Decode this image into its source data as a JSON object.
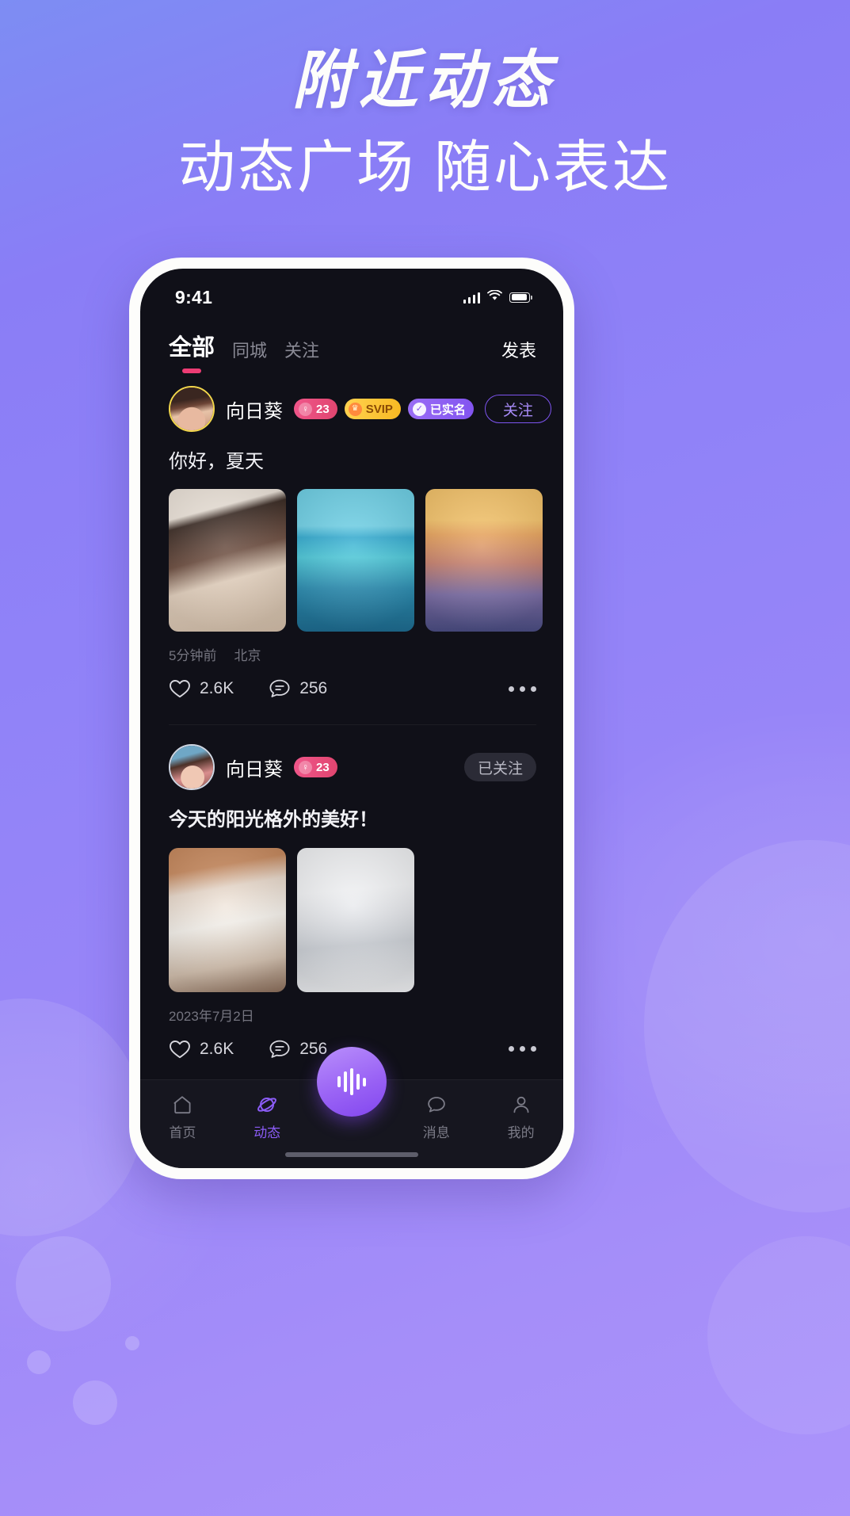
{
  "promo": {
    "title": "附近动态",
    "subtitle": "动态广场 随心表达",
    "bg_start": "#7d8df3",
    "bg_end": "#ab93fa"
  },
  "status_bar": {
    "time": "9:41",
    "signal_icon": "cellular-signal-icon",
    "wifi_icon": "wifi-icon",
    "battery_icon": "battery-icon"
  },
  "top_bar": {
    "tabs": [
      {
        "label": "全部",
        "active": true
      },
      {
        "label": "同城",
        "active": false
      },
      {
        "label": "关注",
        "active": false
      }
    ],
    "publish_label": "发表",
    "indicator_color": "#ec3c74"
  },
  "feed": {
    "posts": [
      {
        "username": "向日葵",
        "avatar_ring_color": "#f2d64b",
        "badges": [
          {
            "type": "age",
            "glyph": "female-icon",
            "text": "23",
            "color": "#ef4d80"
          },
          {
            "type": "svip",
            "glyph": "crown-icon",
            "text": "SVIP",
            "color": "#ffcb45"
          },
          {
            "type": "verified",
            "glyph": "shield-check-icon",
            "text": "已实名",
            "color": "#8b5cf6"
          }
        ],
        "follow": {
          "label": "关注",
          "state": "not-following"
        },
        "text": "你好，夏天",
        "images": 3,
        "meta": {
          "time": "5分钟前",
          "location": "北京"
        },
        "likes": "2.6K",
        "comments": "256",
        "more_label": "more-options"
      },
      {
        "username": "向日葵",
        "avatar_ring_color": "#cfd6e2",
        "badges": [
          {
            "type": "age",
            "glyph": "female-icon",
            "text": "23",
            "color": "#ef4d80"
          }
        ],
        "follow": {
          "label": "已关注",
          "state": "following"
        },
        "text": "今天的阳光格外的美好！",
        "images": 2,
        "meta": {
          "time": "2023年7月2日",
          "location": ""
        },
        "likes": "2.6K",
        "comments": "256",
        "more_label": "more-options"
      }
    ],
    "like_icon": "heart-icon",
    "comment_icon": "comment-bubble-icon"
  },
  "bottom_nav": {
    "items": [
      {
        "label": "首页",
        "icon": "home-icon",
        "active": false
      },
      {
        "label": "动态",
        "icon": "planet-icon",
        "active": true
      },
      {
        "label": "消息",
        "icon": "chat-icon",
        "active": false
      },
      {
        "label": "我的",
        "icon": "person-icon",
        "active": false
      }
    ],
    "fab": {
      "icon": "voice-wave-icon",
      "color": "#9a63f5"
    },
    "active_color": "#8b5cf6"
  }
}
